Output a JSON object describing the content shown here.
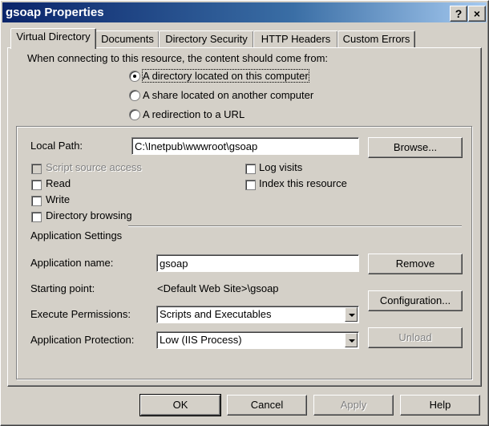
{
  "window": {
    "title": "gsoap Properties",
    "help_button": "?",
    "close_button": "×"
  },
  "tabs": [
    {
      "label": "Virtual Directory",
      "active": true
    },
    {
      "label": "Documents"
    },
    {
      "label": "Directory Security"
    },
    {
      "label": "HTTP Headers"
    },
    {
      "label": "Custom Errors"
    }
  ],
  "content_source": {
    "prompt": "When connecting to this resource, the content should come from:",
    "options": [
      {
        "label": "A directory located on this computer",
        "selected": true
      },
      {
        "label": "A share located on another computer",
        "selected": false
      },
      {
        "label": "A redirection to a URL",
        "selected": false
      }
    ]
  },
  "local_path": {
    "label": "Local Path:",
    "value": "C:\\Inetpub\\wwwroot\\gsoap",
    "browse_label": "Browse..."
  },
  "permissions": {
    "script_source_access": {
      "label": "Script source access",
      "checked": false,
      "disabled": true
    },
    "read": {
      "label": "Read",
      "checked": false
    },
    "write": {
      "label": "Write",
      "checked": false
    },
    "directory_browsing": {
      "label": "Directory browsing",
      "checked": false
    },
    "log_visits": {
      "label": "Log visits",
      "checked": false
    },
    "index_resource": {
      "label": "Index this resource",
      "checked": false
    }
  },
  "app_settings": {
    "heading": "Application Settings",
    "name_label": "Application name:",
    "name_value": "gsoap",
    "remove_label": "Remove",
    "starting_point_label": "Starting point:",
    "starting_point_value": "<Default Web Site>\\gsoap",
    "configuration_label": "Configuration...",
    "execute_label": "Execute Permissions:",
    "execute_value": "Scripts and Executables",
    "protection_label": "Application Protection:",
    "protection_value": "Low (IIS Process)",
    "unload_label": "Unload"
  },
  "footer": {
    "ok": "OK",
    "cancel": "Cancel",
    "apply": "Apply",
    "help": "Help"
  }
}
